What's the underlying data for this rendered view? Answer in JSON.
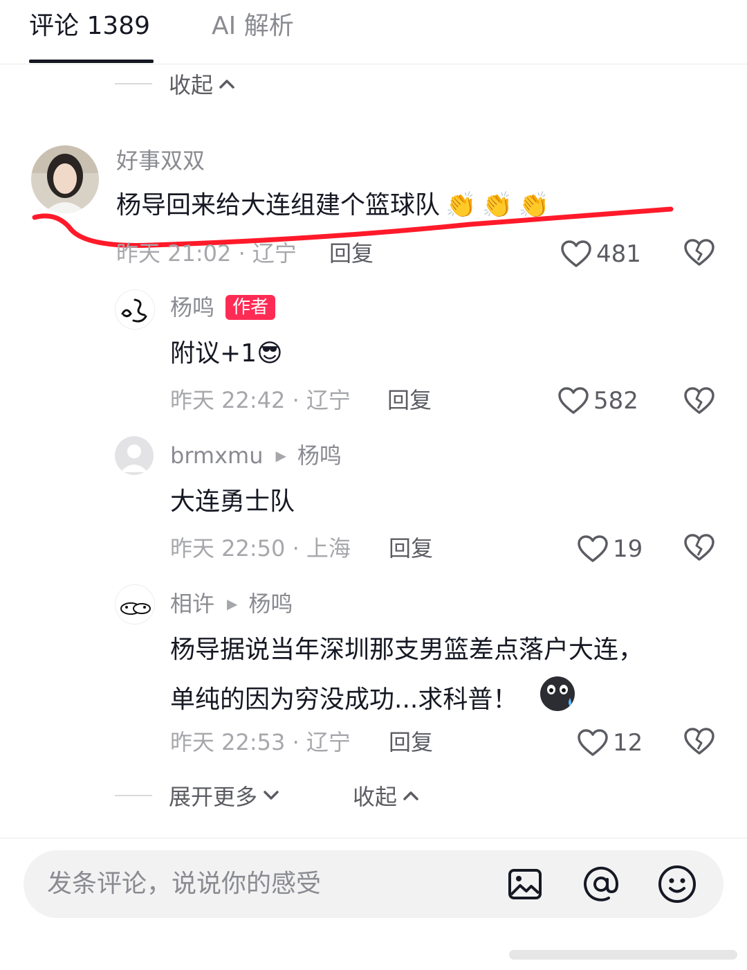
{
  "tabs": {
    "comments": "评论 1389",
    "ai": "AI 解析"
  },
  "collapse_top": "收起",
  "comments": [
    {
      "username": "好事双双",
      "text": "杨导回来给大连组建个篮球队",
      "emoji": "👏👏👏",
      "meta": "昨天 21:02 · 辽宁",
      "reply": "回复",
      "likes": "481"
    }
  ],
  "replies": [
    {
      "username": "杨鸣",
      "badge": "作者",
      "text": "附议+1",
      "emoji": "😎",
      "meta": "昨天 22:42 · 辽宁",
      "reply": "回复",
      "likes": "582"
    },
    {
      "username": "brmxmu",
      "reply_to": "杨鸣",
      "text": "大连勇士队",
      "meta": "昨天 22:50 · 上海",
      "reply": "回复",
      "likes": "19"
    },
    {
      "username": "相许",
      "reply_to": "杨鸣",
      "text_line1": "杨导据说当年深圳那支男篮差点落户大连，",
      "text_line2": "单纯的因为穷没成功...求科普！",
      "meta": "昨天 22:53 · 辽宁",
      "reply": "回复",
      "likes": "12"
    }
  ],
  "expand_more": "展开更多",
  "collapse_bottom": "收起",
  "input": {
    "placeholder": "发条评论，说说你的感受"
  },
  "annotation": {
    "type": "red-underline",
    "color": "#ff1a2a"
  },
  "icons": [
    "heart-icon",
    "broken-heart-icon",
    "image-icon",
    "at-icon",
    "smiley-icon",
    "chevron-up-icon",
    "chevron-down-icon",
    "play-arrow-icon"
  ]
}
